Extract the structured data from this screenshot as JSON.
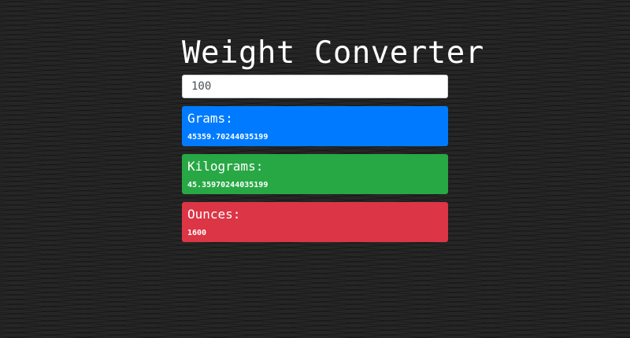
{
  "app": {
    "title": "Weight Converter"
  },
  "input": {
    "value": "100"
  },
  "results": [
    {
      "label": "Grams:",
      "value": "45359.70244035199",
      "color": "#007bff"
    },
    {
      "label": "Kilograms:",
      "value": "45.35970244035199",
      "color": "#28a745"
    },
    {
      "label": "Ounces:",
      "value": "1600",
      "color": "#dc3545"
    }
  ]
}
